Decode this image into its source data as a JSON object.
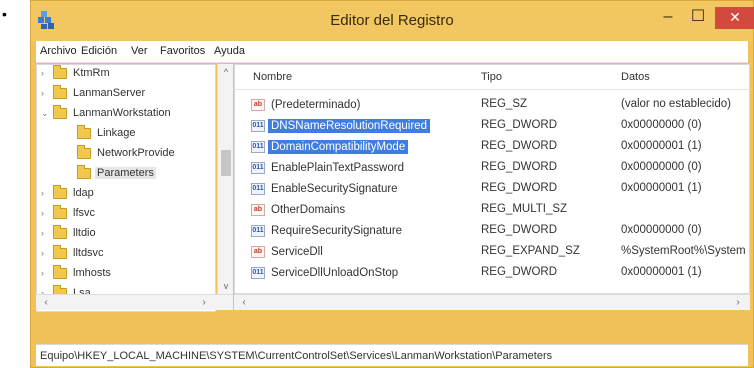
{
  "bullet": "•",
  "window": {
    "title": "Editor del Registro",
    "minimize": "–",
    "maximize": "☐",
    "close": "✕",
    "colors": {
      "frame": "#f0c257",
      "close": "#d24a3e",
      "selection": "#3f7ee0"
    }
  },
  "menu": [
    "Archivo",
    "Edición",
    "Ver",
    "Favoritos",
    "Ayuda"
  ],
  "tree": {
    "items": [
      {
        "label": "KtmRm",
        "expander": "›"
      },
      {
        "label": "LanmanServer",
        "expander": "›"
      },
      {
        "label": "LanmanWorkstation",
        "expander": "⌄"
      },
      {
        "label": "Linkage",
        "expander": ""
      },
      {
        "label": "NetworkProvide",
        "expander": ""
      },
      {
        "label": "Parameters",
        "expander": ""
      },
      {
        "label": "ldap",
        "expander": "›"
      },
      {
        "label": "lfsvc",
        "expander": "›"
      },
      {
        "label": "lltdio",
        "expander": "›"
      },
      {
        "label": "lltdsvc",
        "expander": "›"
      },
      {
        "label": "lmhosts",
        "expander": "›"
      },
      {
        "label": "Lsa",
        "expander": "›"
      }
    ]
  },
  "list": {
    "columns": {
      "name": "Nombre",
      "type": "Tipo",
      "data": "Datos"
    },
    "rows": [
      {
        "icon": "string-value-icon",
        "glyph": "ab",
        "name": "(Predeterminado)",
        "type": "REG_SZ",
        "data": "(valor no establecido)"
      },
      {
        "icon": "binary-value-icon",
        "glyph": "011",
        "name": "DNSNameResolutionRequired",
        "type": "REG_DWORD",
        "data": "0x00000000 (0)"
      },
      {
        "icon": "binary-value-icon",
        "glyph": "011",
        "name": "DomainCompatibilityMode",
        "type": "REG_DWORD",
        "data": "0x00000001 (1)"
      },
      {
        "icon": "binary-value-icon",
        "glyph": "011",
        "name": "EnablePlainTextPassword",
        "type": "REG_DWORD",
        "data": "0x00000000 (0)"
      },
      {
        "icon": "binary-value-icon",
        "glyph": "011",
        "name": "EnableSecuritySignature",
        "type": "REG_DWORD",
        "data": "0x00000001 (1)"
      },
      {
        "icon": "string-value-icon",
        "glyph": "ab",
        "name": "OtherDomains",
        "type": "REG_MULTI_SZ",
        "data": ""
      },
      {
        "icon": "binary-value-icon",
        "glyph": "011",
        "name": "RequireSecuritySignature",
        "type": "REG_DWORD",
        "data": "0x00000000 (0)"
      },
      {
        "icon": "string-value-icon",
        "glyph": "ab",
        "name": "ServiceDll",
        "type": "REG_EXPAND_SZ",
        "data": "%SystemRoot%\\System"
      },
      {
        "icon": "binary-value-icon",
        "glyph": "011",
        "name": "ServiceDllUnloadOnStop",
        "type": "REG_DWORD",
        "data": "0x00000001 (1)"
      }
    ]
  },
  "statusbar": "Equipo\\HKEY_LOCAL_MACHINE\\SYSTEM\\CurrentControlSet\\Services\\LanmanWorkstation\\Parameters"
}
